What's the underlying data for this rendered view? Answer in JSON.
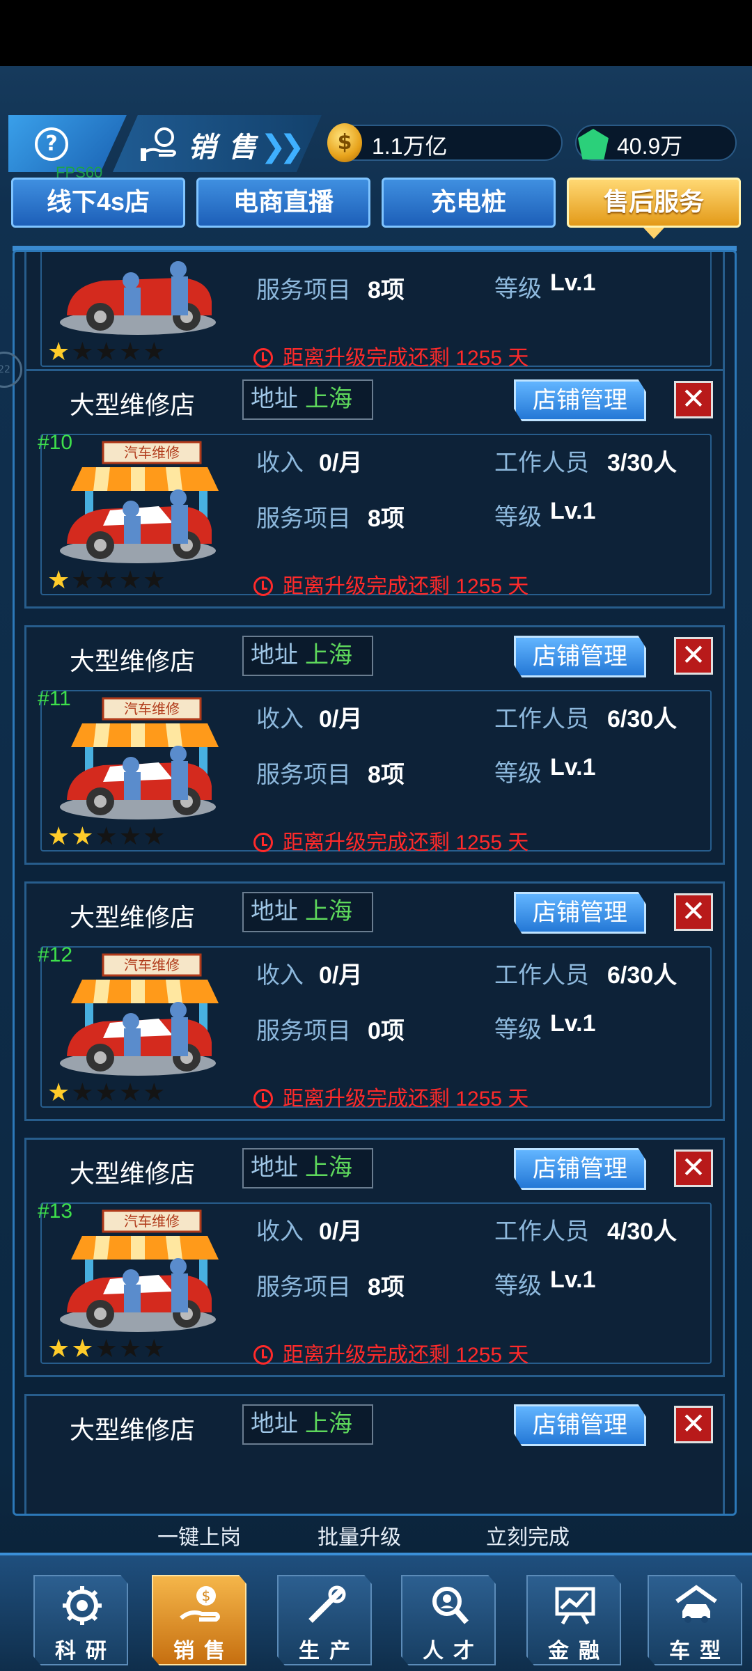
{
  "header": {
    "help_symbol": "?",
    "section_title": "销售",
    "gold": "1.1万亿",
    "gems": "40.9万",
    "fps": "FPS60"
  },
  "tabs": [
    {
      "label": "线下4s店",
      "active": false
    },
    {
      "label": "电商直播",
      "active": false
    },
    {
      "label": "充电桩",
      "active": false
    },
    {
      "label": "售后服务",
      "active": true
    }
  ],
  "labels": {
    "address": "地址",
    "manage": "店铺管理",
    "income": "收入",
    "staff": "工作人员",
    "service_items": "服务项目",
    "level": "等级",
    "close_symbol": "✕"
  },
  "partial_top_card": {
    "service_items": "8项",
    "level": "Lv.1",
    "timer": "距离升级完成还剩 1255 天",
    "stars": 1
  },
  "shops": [
    {
      "name": "大型维修店",
      "city": "上海",
      "rank": "#10",
      "income": "0/月",
      "staff": "3/30人",
      "service_items": "8项",
      "level": "Lv.1",
      "timer": "距离升级完成还剩 1255 天",
      "stars": 1
    },
    {
      "name": "大型维修店",
      "city": "上海",
      "rank": "#11",
      "income": "0/月",
      "staff": "6/30人",
      "service_items": "8项",
      "level": "Lv.1",
      "timer": "距离升级完成还剩 1255 天",
      "stars": 2
    },
    {
      "name": "大型维修店",
      "city": "上海",
      "rank": "#12",
      "income": "0/月",
      "staff": "6/30人",
      "service_items": "0项",
      "level": "Lv.1",
      "timer": "距离升级完成还剩 1255 天",
      "stars": 1
    },
    {
      "name": "大型维修店",
      "city": "上海",
      "rank": "#13",
      "income": "0/月",
      "staff": "4/30人",
      "service_items": "8项",
      "level": "Lv.1",
      "timer": "距离升级完成还剩 1255 天",
      "stars": 2
    }
  ],
  "partial_bottom_card": {
    "name": "大型维修店",
    "city": "上海"
  },
  "actions": [
    "一键上岗",
    "批量升级",
    "立刻完成"
  ],
  "nav": [
    {
      "label": "科研",
      "icon": "research-gear-icon",
      "active": false
    },
    {
      "label": "销售",
      "icon": "sales-coin-hand-icon",
      "active": true
    },
    {
      "label": "生产",
      "icon": "production-tools-icon",
      "active": false
    },
    {
      "label": "人才",
      "icon": "talent-search-icon",
      "active": false
    },
    {
      "label": "金融",
      "icon": "finance-chart-icon",
      "active": false
    },
    {
      "label": "车型",
      "icon": "car-garage-icon",
      "active": false
    }
  ],
  "signboard": "汽车维修"
}
